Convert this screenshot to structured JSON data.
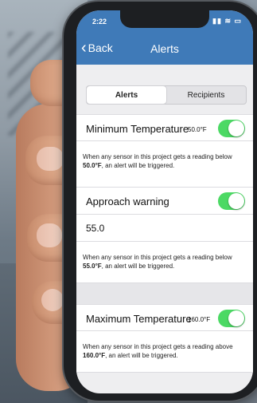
{
  "status": {
    "time": "2:22",
    "icons": "▮▮ ≋ ▭"
  },
  "nav": {
    "back_label": "Back",
    "title": "Alerts"
  },
  "tabs": [
    {
      "label": "Alerts",
      "active": true
    },
    {
      "label": "Recipients",
      "active": false
    }
  ],
  "min_temp": {
    "label": "Minimum Temperature",
    "value": "50.0°F",
    "enabled": true,
    "desc_prefix": "When any sensor in this project gets a reading below ",
    "desc_value": "50.0°F",
    "desc_suffix": ", an alert will be triggered."
  },
  "approach": {
    "label": "Approach warning",
    "enabled": true,
    "input_value": "55.0",
    "desc_prefix": "When any sensor in this project gets a reading below ",
    "desc_value": "55.0°F",
    "desc_suffix": ", an alert will be triggered."
  },
  "max_temp": {
    "label": "Maximum Temperature",
    "value": "160.0°F",
    "enabled": true,
    "desc_prefix": "When any sensor in this project gets a reading above ",
    "desc_value": "160.0°F",
    "desc_suffix": ", an alert will be triggered."
  },
  "colors": {
    "nav": "#3f7ab8",
    "toggle_on": "#4cd964"
  }
}
